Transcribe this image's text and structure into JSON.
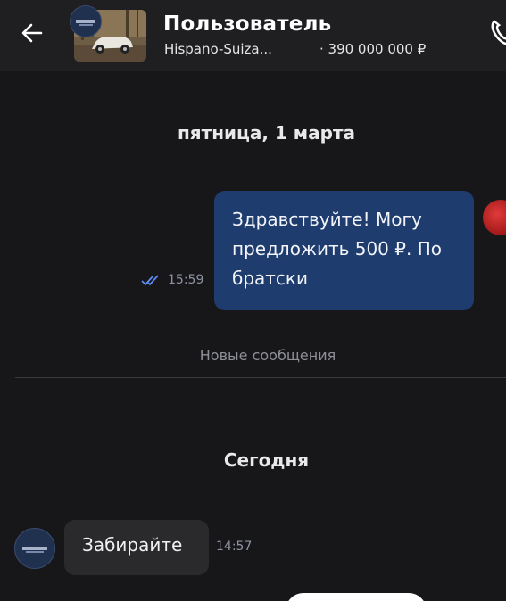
{
  "header": {
    "title": "Пользователь",
    "listing_name": "Hispano-Suiza...",
    "listing_price": "· 390 000 000 ₽",
    "back_icon": "arrow-left-icon",
    "call_icon": "phone-icon"
  },
  "chat": {
    "date_separator_1": "пятница, 1 марта",
    "outgoing_message": {
      "text": "Здравствуйте! Могу предложить 500 ₽. По братски",
      "time": "15:59",
      "status_icon": "double-check-icon"
    },
    "new_messages_label": "Новые сообщения",
    "date_separator_2": "Сегодня",
    "incoming_message": {
      "text": "Забирайте",
      "time": "14:57"
    }
  },
  "colors": {
    "background": "#17171a",
    "outgoing_bubble": "#1e3c6d",
    "incoming_bubble": "#2a2a2c",
    "read_check": "#5b8cf0"
  }
}
